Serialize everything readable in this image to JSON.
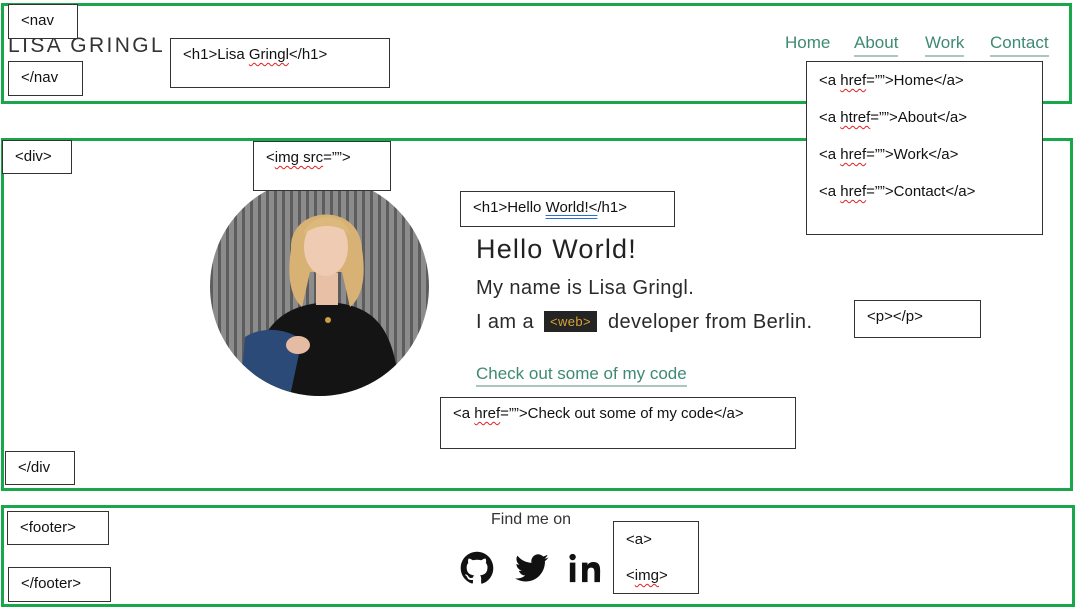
{
  "header": {
    "logo_text": "LISA GRINGL",
    "nav_links": [
      {
        "label": "Home"
      },
      {
        "label": "About"
      },
      {
        "label": "Work"
      },
      {
        "label": "Contact"
      }
    ]
  },
  "hero": {
    "heading": "Hello World!",
    "intro_line1": "My name is Lisa Gringl.",
    "intro_line2_before": "I am a",
    "web_tag": "<web>",
    "intro_line2_after": "developer from Berlin.",
    "code_link": "Check out some of my code"
  },
  "footer": {
    "find_me": "Find me on",
    "social_icons": [
      "github-icon",
      "twitter-icon",
      "linkedin-icon"
    ]
  },
  "annotations": {
    "nav_open": "<nav",
    "nav_close": "</nav",
    "h1_logo_a": "<h1>Lisa ",
    "h1_logo_b": "Gringl",
    "h1_logo_c": "</h1>",
    "a_links": [
      {
        "a": "<a ",
        "b": "href",
        "c": "=””>Home</a>"
      },
      {
        "a": "<a ",
        "b": "htref",
        "c": "=””>About</a>"
      },
      {
        "a": "<a ",
        "b": "href",
        "c": "=””>Work</a>"
      },
      {
        "a": "<a ",
        "b": "href",
        "c": "=””>Contact</a>"
      }
    ],
    "div_open": "<div>",
    "div_close": "</div",
    "img_src_a": "<",
    "img_src_b": "img src",
    "img_src_c": "=””>",
    "h1_hello_a": "<h1>Hello ",
    "h1_hello_b": "World!<",
    "h1_hello_c": "/h1>",
    "p_tag": "<p></p>",
    "a_code_a": "<a ",
    "a_code_b": "href",
    "a_code_c": "=””>Check out some of my code</a>",
    "footer_open": "<footer>",
    "footer_close": "</footer>",
    "a_tag": "<a>",
    "img_tag_a": "<",
    "img_tag_b": "img",
    "img_tag_c": ">"
  },
  "colors": {
    "frame": "#1aa64a",
    "link": "#3e8a74",
    "link_underline": "#a9c7bd",
    "web_tag_bg": "#242424",
    "web_tag_text": "#d9a23b"
  }
}
